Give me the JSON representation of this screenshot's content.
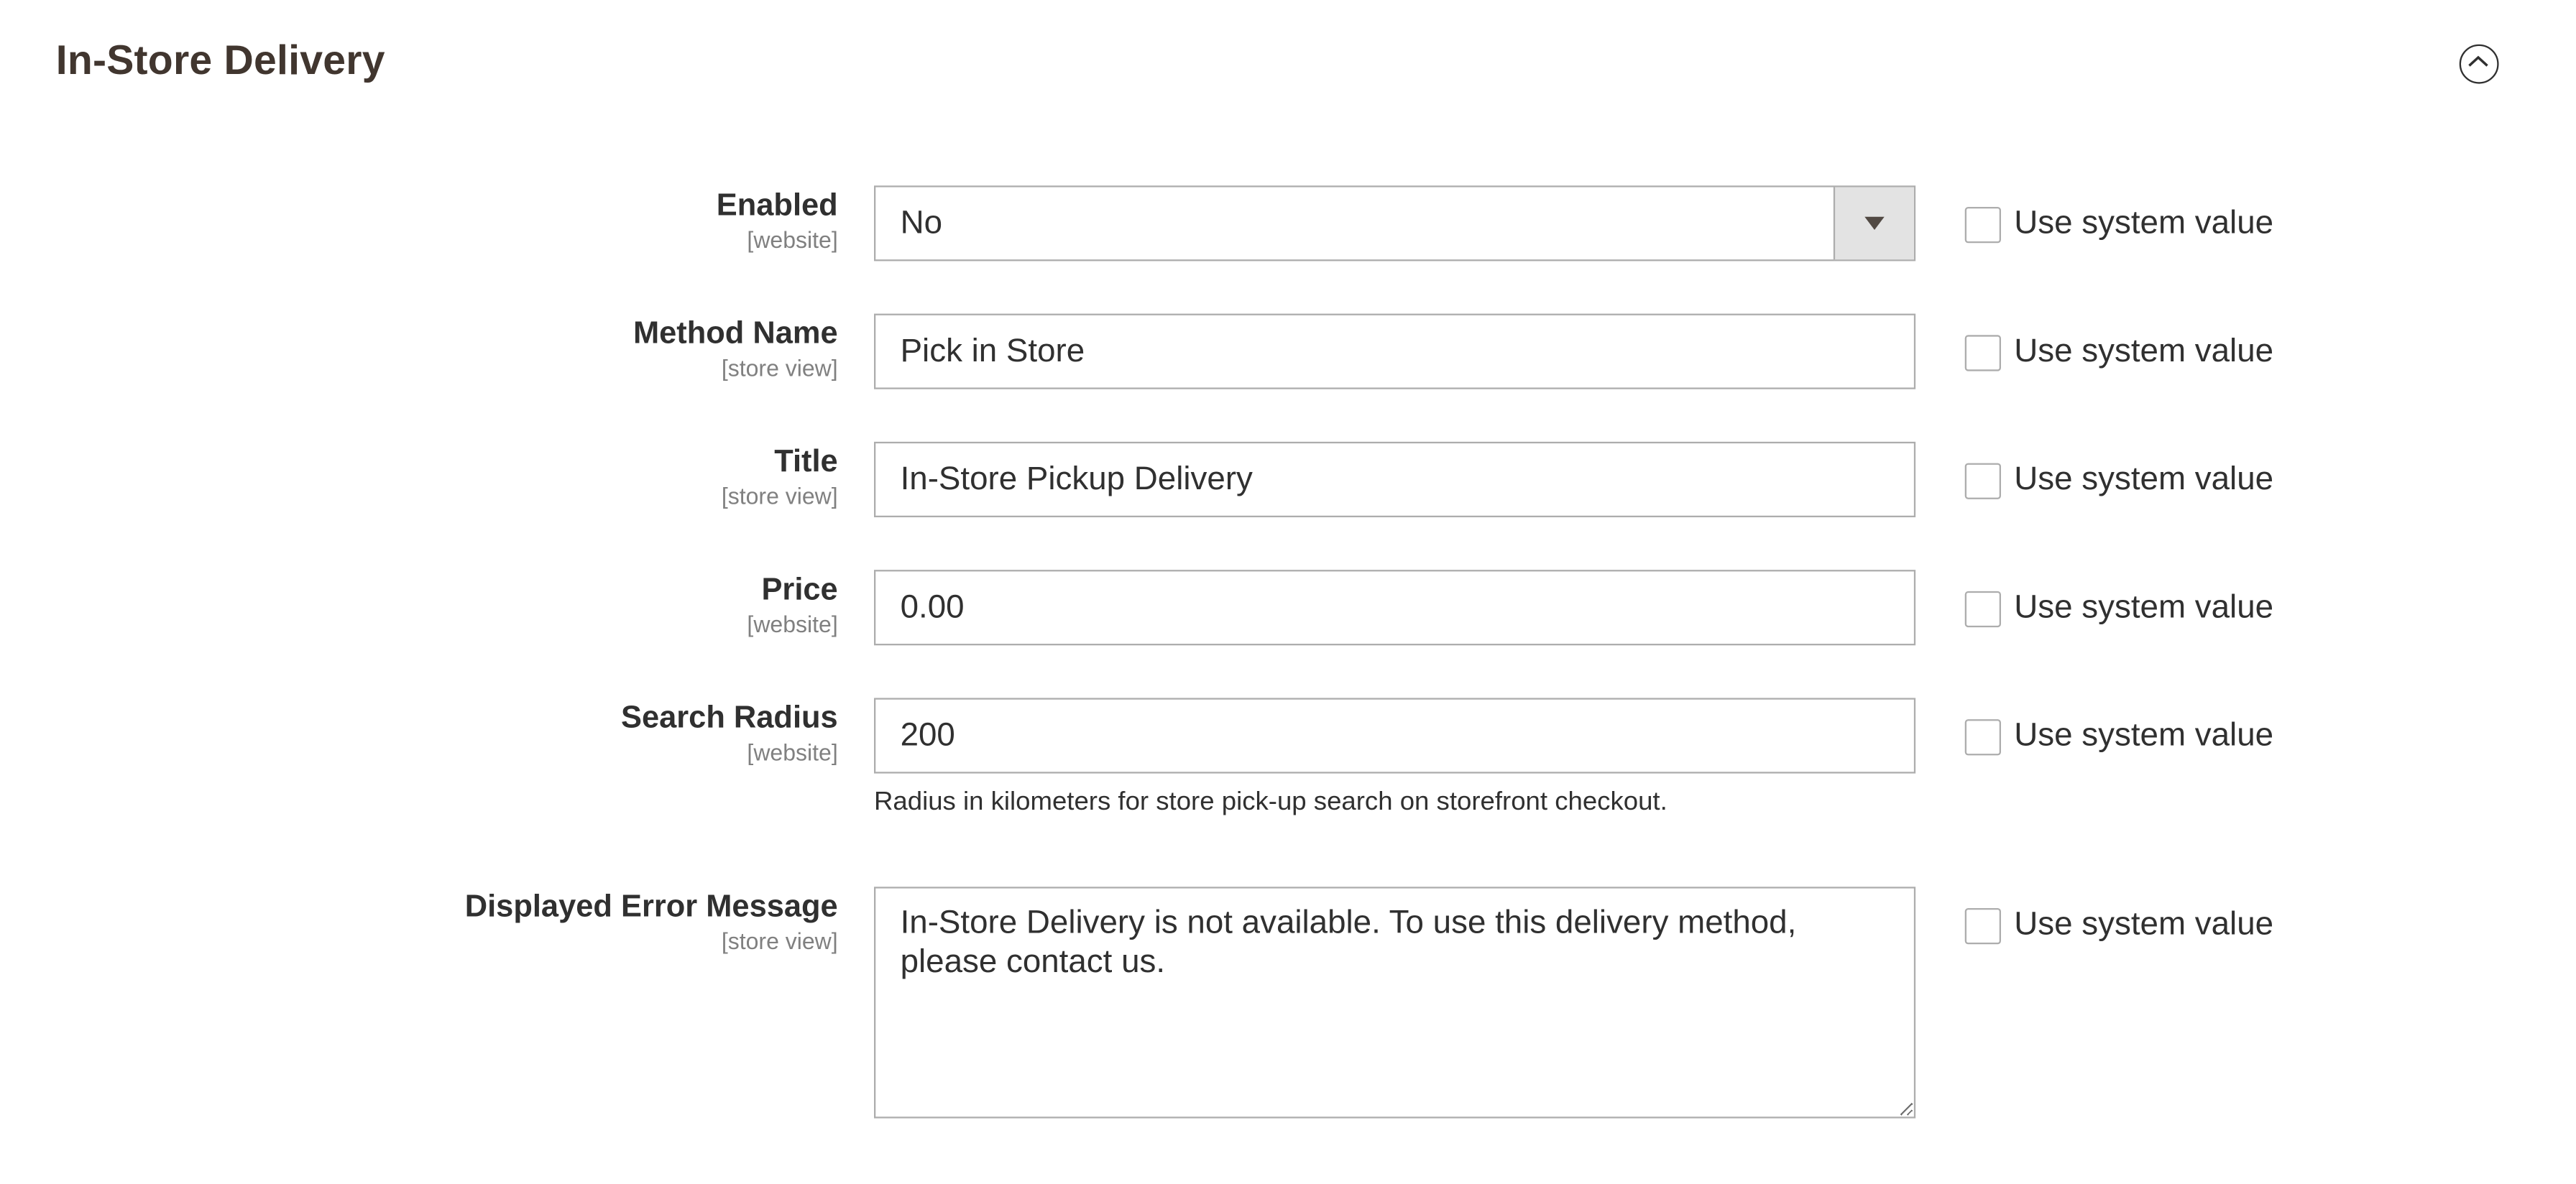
{
  "section": {
    "title": "In-Store Delivery",
    "collapse_icon": "chevron-up-circle-icon"
  },
  "use_system_value_label": "Use system value",
  "fields": [
    {
      "label": "Enabled",
      "scope": "[website]",
      "type": "select",
      "value": "No",
      "use_system_value": false
    },
    {
      "label": "Method Name",
      "scope": "[store view]",
      "type": "text",
      "value": "Pick in Store",
      "use_system_value": false
    },
    {
      "label": "Title",
      "scope": "[store view]",
      "type": "text",
      "value": "In-Store Pickup Delivery",
      "use_system_value": false
    },
    {
      "label": "Price",
      "scope": "[website]",
      "type": "text",
      "value": "0.00",
      "use_system_value": false
    },
    {
      "label": "Search Radius",
      "scope": "[website]",
      "type": "text",
      "value": "200",
      "note": "Radius in kilometers for store pick-up search on storefront checkout.",
      "use_system_value": false
    },
    {
      "label": "Displayed Error Message",
      "scope": "[store view]",
      "type": "textarea",
      "value": "In-Store Delivery is not available. To use this delivery method, please contact us.",
      "use_system_value": false
    }
  ]
}
